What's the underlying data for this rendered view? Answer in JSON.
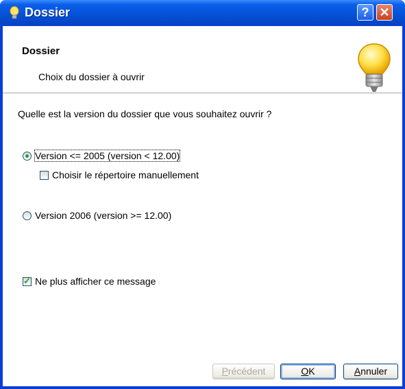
{
  "window": {
    "title": "Dossier",
    "help_label": "?",
    "close_label": "✕"
  },
  "header": {
    "title": "Dossier",
    "subtitle": "Choix du dossier à ouvrir"
  },
  "question": "Quelle est la version du dossier que vous souhaitez ouvrir ?",
  "options": {
    "v2005": {
      "label": "Version <= 2005 (version < 12.00)",
      "selected": true
    },
    "manual_dir": {
      "label": "Choisir le répertoire manuellement",
      "checked": false
    },
    "v2006": {
      "label": "Version 2006 (version >= 12.00)",
      "selected": false
    },
    "no_show": {
      "label": "Ne plus afficher ce message",
      "checked": true
    }
  },
  "buttons": {
    "prev": {
      "label_mn": "P",
      "label_rest": "récédent"
    },
    "ok": {
      "label_mn": "O",
      "label_rest": "K"
    },
    "cancel": {
      "label_mn": "A",
      "label_rest": "nnuler"
    }
  }
}
